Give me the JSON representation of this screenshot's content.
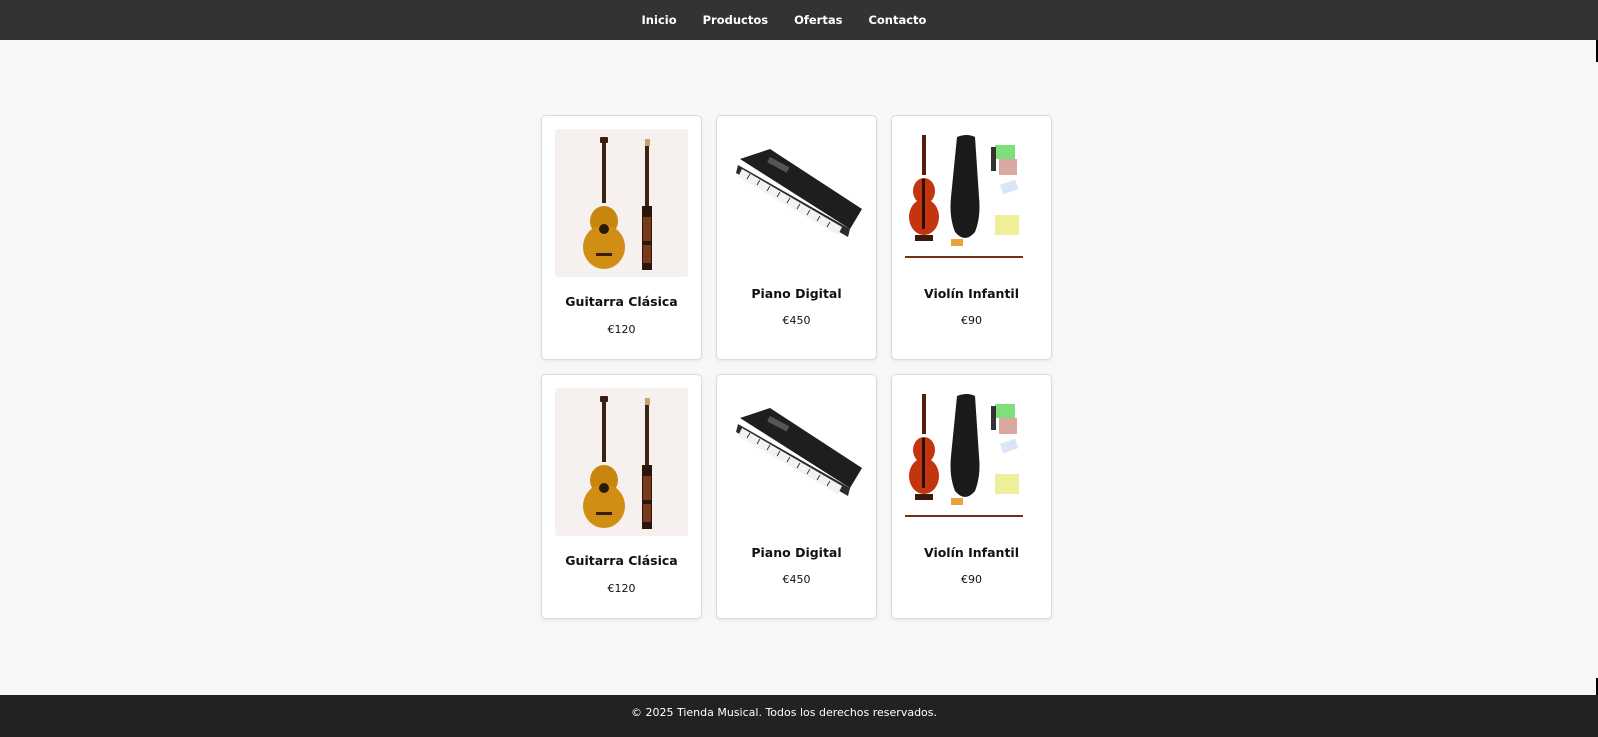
{
  "nav": {
    "items": [
      {
        "label": "Inicio"
      },
      {
        "label": "Productos"
      },
      {
        "label": "Ofertas"
      },
      {
        "label": "Contacto"
      }
    ]
  },
  "products": [
    {
      "name": "Guitarra Clásica",
      "price": "€120",
      "image": "classical-guitar-image"
    },
    {
      "name": "Piano Digital",
      "price": "€450",
      "image": "digital-piano-image"
    },
    {
      "name": "Violín Infantil",
      "price": "€90",
      "image": "kids-violin-set-image"
    },
    {
      "name": "Guitarra Clásica",
      "price": "€120",
      "image": "classical-guitar-image"
    },
    {
      "name": "Piano Digital",
      "price": "€450",
      "image": "digital-piano-image"
    },
    {
      "name": "Violín Infantil",
      "price": "€90",
      "image": "kids-violin-set-image"
    }
  ],
  "footer": {
    "text": "© 2025 Tienda Musical. Todos los derechos reservados."
  },
  "colors": {
    "topbar": "#333333",
    "footer": "#222222",
    "page_bg": "#f7f7f7",
    "card_bg": "#ffffff"
  }
}
